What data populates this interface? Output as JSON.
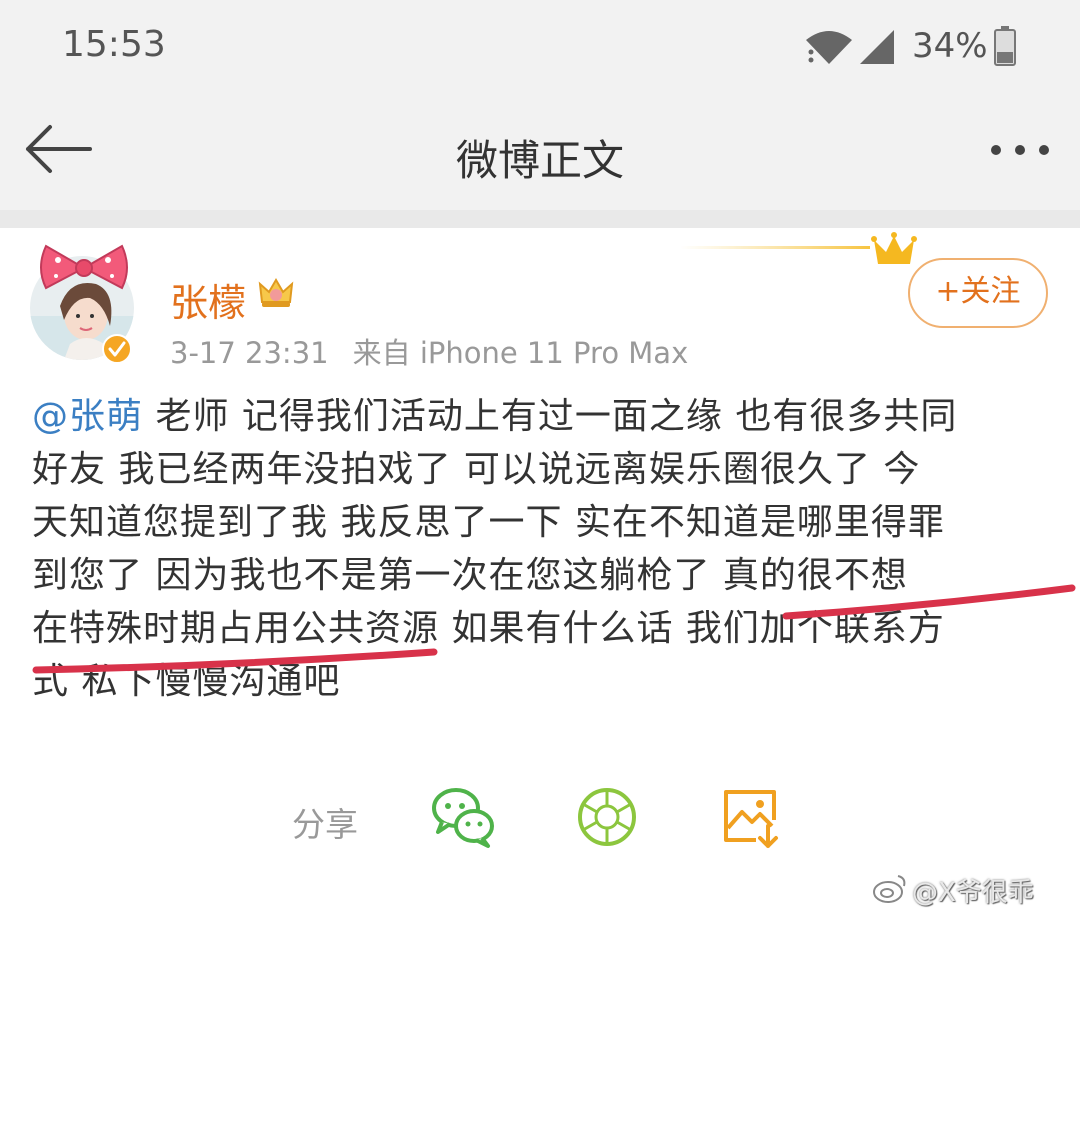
{
  "status_bar": {
    "time": "15:53",
    "battery_percent": "34%",
    "icons": [
      "wifi-icon",
      "cellular-signal-icon",
      "battery-icon"
    ]
  },
  "nav": {
    "title": "微博正文",
    "back_icon": "back-arrow-icon",
    "more_icon": "more-dots-icon"
  },
  "post": {
    "author": "张檬",
    "timestamp": "3-17 23:31",
    "source": "来自 iPhone 11 Pro Max",
    "follow_label": "+关注",
    "mention": "@张萌",
    "lines": [
      " 老师  记得我们活动上有过一面之缘  也有很多共同",
      "好友   我已经两年没拍戏了  可以说远离娱乐圈很久了  今",
      "天知道您提到了我  我反思了一下  实在不知道是哪里得罪",
      "到您了   因为我也不是第一次在您这躺枪了    真的很不想",
      "在特殊时期占用公共资源   如果有什么话   我们加个联系方",
      "式  私下慢慢沟通吧"
    ]
  },
  "share": {
    "label": "分享",
    "icons": [
      "wechat-icon",
      "moments-icon",
      "save-image-icon"
    ]
  },
  "watermark": "@X爷很乖",
  "colors": {
    "username": "#e2711d",
    "mention": "#3b7fc3",
    "underline": "#d8324a",
    "wechat": "#4fb34a",
    "save": "#f0a020"
  }
}
